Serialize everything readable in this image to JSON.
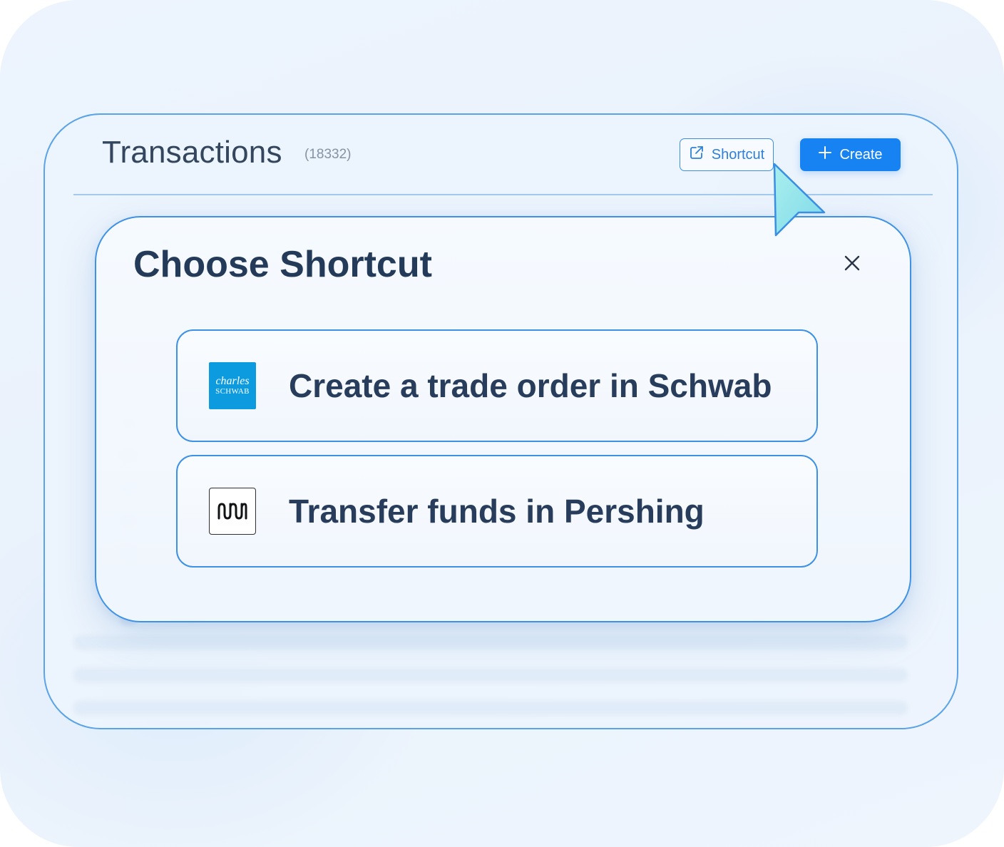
{
  "page": {
    "title": "Transactions",
    "count": "(18332)"
  },
  "toolbar": {
    "shortcut_label": "Shortcut",
    "create_label": "Create"
  },
  "modal": {
    "title": "Choose Shortcut",
    "options": [
      {
        "label": "Create a trade order in Schwab",
        "logo_text_top": "charles",
        "logo_text_bottom": "SCHWAB",
        "logo_color": "#0d9be0"
      },
      {
        "label": "Transfer funds in Pershing",
        "logo_icon": "pershing-logo"
      }
    ]
  },
  "colors": {
    "accent": "#1783f2",
    "title_text": "#243a59",
    "border": "#3e92e6"
  },
  "icons": {
    "shortcut": "external-link-icon",
    "create": "plus-icon",
    "close": "close-icon",
    "cursor": "mouse-pointer-icon"
  }
}
